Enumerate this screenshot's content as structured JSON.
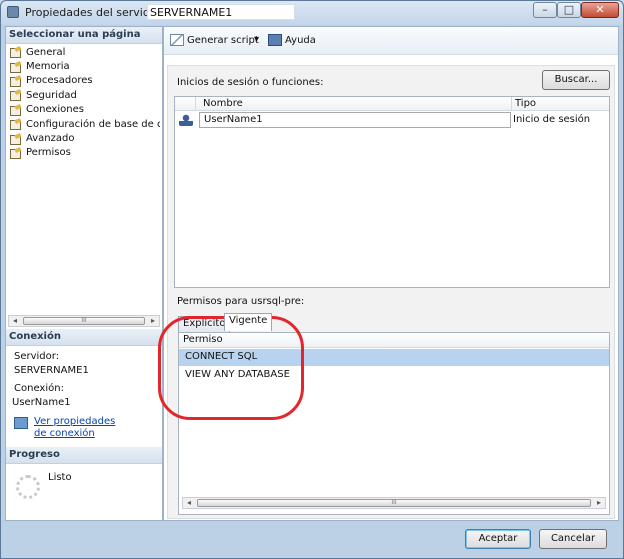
{
  "window": {
    "title": "Propiedades del servidor:",
    "server_name": "SERVERNAME1",
    "controls": {
      "minimize": "–",
      "maximize": "□",
      "close": "✕"
    }
  },
  "sidebar": {
    "header": "Seleccionar una página",
    "pages": [
      "General",
      "Memoria",
      "Procesadores",
      "Seguridad",
      "Conexiones",
      "Configuración de base de datos",
      "Avanzado",
      "Permisos"
    ],
    "scroll": {
      "left": "◂",
      "right": "▸",
      "thumb": "III"
    }
  },
  "connection": {
    "header": "Conexión",
    "server_label": "Servidor:",
    "server_value": "SERVERNAME1",
    "connection_label": "Conexión:",
    "connection_value": "UserName1",
    "link": "Ver propiedades de conexión"
  },
  "progress": {
    "header": "Progreso",
    "status": "Listo"
  },
  "toolbar": {
    "script_label": "Generar script",
    "dropdown_arrow": "▾",
    "help_label": "Ayuda"
  },
  "logins": {
    "label": "Inicios de sesión o funciones:",
    "search_button": "Buscar...",
    "columns": {
      "name": "Nombre",
      "type": "Tipo"
    },
    "rows": [
      {
        "name": "UserName1",
        "type": "Inicio de sesión"
      }
    ]
  },
  "permissions": {
    "label": "Permisos para usrsql-pre:",
    "tabs": [
      "Explícito",
      "Vigente"
    ],
    "column": "Permiso",
    "rows": [
      "CONNECT SQL",
      "VIEW ANY DATABASE"
    ],
    "scroll": {
      "left": "◂",
      "right": "▸",
      "thumb": "III"
    }
  },
  "footer": {
    "ok": "Aceptar",
    "cancel": "Cancelar"
  },
  "colors": {
    "annotation_oval": "#e2262c",
    "selected_row": "#b8d3f0",
    "link": "#0645ad"
  }
}
